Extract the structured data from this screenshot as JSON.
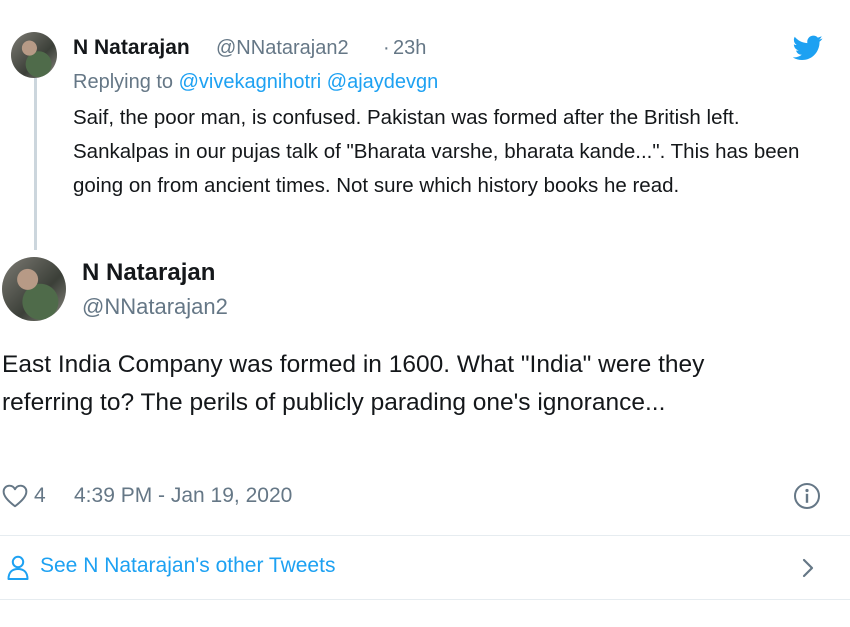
{
  "reply_tweet": {
    "author_name": "N Natarajan",
    "author_handle": "@NNatarajan2",
    "separator": "·",
    "time_ago": "23h",
    "replying_prefix": "Replying to",
    "replying_to": [
      "@vivekagnihotri",
      "@ajaydevgn"
    ],
    "text": "Saif, the poor man, is confused. Pakistan was formed after the British left. Sankalpas in our pujas talk of \"Bharata varshe, bharata kande...\". This has been going on from ancient times. Not sure which history books he read."
  },
  "main_tweet": {
    "author_name": "N Natarajan",
    "author_handle": "@NNatarajan2",
    "text": "East India Company was formed in 1600. What \"India\" were they referring to? The perils of publicly parading one's ignorance...",
    "likes_count": "4",
    "timestamp": "4:39 PM - Jan 19, 2020"
  },
  "footer": {
    "see_more_label": "See N Natarajan's other Tweets"
  },
  "icons": {
    "brand": "twitter-bird-icon",
    "like": "heart-outline-icon",
    "info": "info-icon",
    "profile": "person-icon",
    "navigate": "chevron-right-icon"
  },
  "colors": {
    "accent": "#1da1f2",
    "secondary_text": "#657786",
    "primary_text": "#14171a"
  }
}
